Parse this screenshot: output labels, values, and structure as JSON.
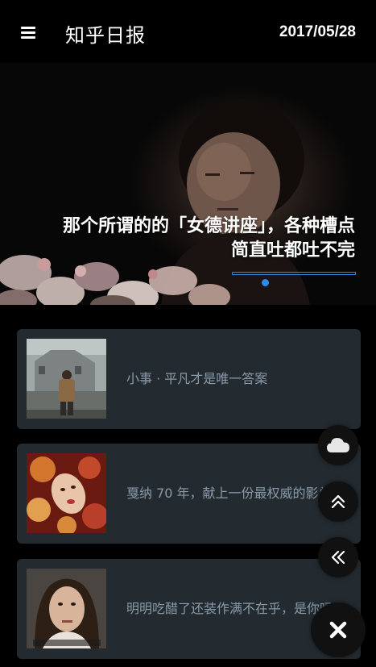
{
  "header": {
    "title": "知乎日报",
    "date": "2017/05/28",
    "menu_icon": "hamburger-menu-icon"
  },
  "hero": {
    "title": "那个所谓的的「女德讲座」，各种槽点简直吐都吐不完",
    "indicator_color": "#2b8cf0"
  },
  "stories": [
    {
      "title": "小事 · 平凡才是唯一答案"
    },
    {
      "title": "戛纳 70 年，献上一份最权威的影单"
    },
    {
      "title": "明明吃醋了还装作满不在乎，是你吗？"
    }
  ],
  "fabs": [
    {
      "icon": "cloud-icon"
    },
    {
      "icon": "double-chevron-up-icon"
    },
    {
      "icon": "double-chevron-left-icon"
    },
    {
      "icon": "close-icon"
    }
  ],
  "colors": {
    "background": "#000000",
    "card": "#232b31",
    "card_text": "#8a9aa8",
    "accent": "#2b8cf0"
  }
}
